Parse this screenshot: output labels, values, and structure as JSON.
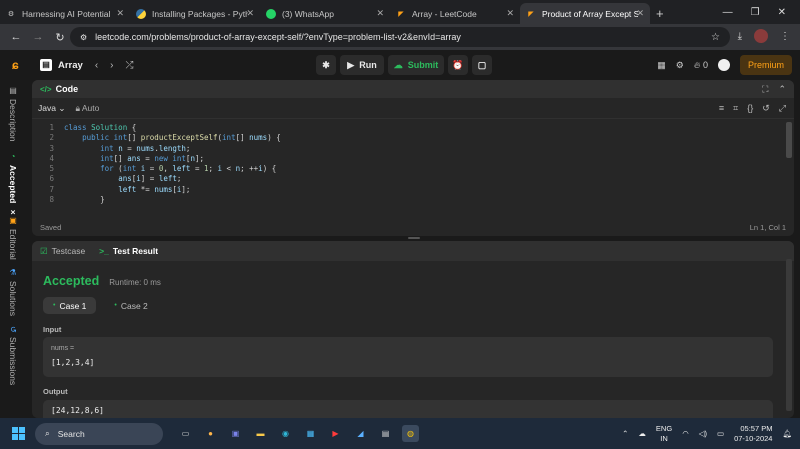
{
  "browser": {
    "tabs": [
      {
        "label": "Harnessing AI Potential",
        "icon": "gear-favicon-icon",
        "active": false
      },
      {
        "label": "Installing Packages - Python",
        "icon": "python-favicon-icon",
        "active": false
      },
      {
        "label": "(3) WhatsApp",
        "icon": "whatsapp-favicon-icon",
        "active": false
      },
      {
        "label": "Array - LeetCode",
        "icon": "leetcode-favicon-icon",
        "active": false
      },
      {
        "label": "Product of Array Except Self",
        "icon": "leetcode-favicon-icon",
        "active": true
      }
    ],
    "url": "leetcode.com/problems/product-of-array-except-self/?envType=problem-list-v2&envId=array"
  },
  "header": {
    "problem_list": "Array",
    "run_label": "Run",
    "submit_label": "Submit",
    "notif_count": "0",
    "premium_label": "Premium"
  },
  "sidebar": {
    "items": [
      {
        "label": "Description"
      },
      {
        "label": "Accepted",
        "close": "×"
      },
      {
        "label": "Editorial"
      },
      {
        "label": "Solutions"
      },
      {
        "label": "Submissions"
      }
    ]
  },
  "code_panel": {
    "title": "Code",
    "language": "Java",
    "mode": "Auto",
    "status": "Saved",
    "cursor": "Ln 1, Col 1",
    "line_numbers": [
      "1",
      "2",
      "3",
      "4",
      "5",
      "6",
      "7",
      "8"
    ]
  },
  "test_panel": {
    "tab_testcase": "Testcase",
    "tab_result": "Test Result",
    "verdict": "Accepted",
    "runtime": "Runtime: 0 ms",
    "cases": [
      "Case 1",
      "Case 2"
    ],
    "input_label": "Input",
    "input_name": "nums =",
    "input_value": "[1,2,3,4]",
    "output_label": "Output",
    "output_value": "[24,12,8,6]"
  },
  "taskbar": {
    "search_placeholder": "Search",
    "lang_top": "ENG",
    "lang_bottom": "IN",
    "time": "05:57 PM",
    "date": "07-10-2024"
  },
  "colors": {
    "accent_green": "#2cbb5d",
    "premium_orange": "#ffa116"
  }
}
